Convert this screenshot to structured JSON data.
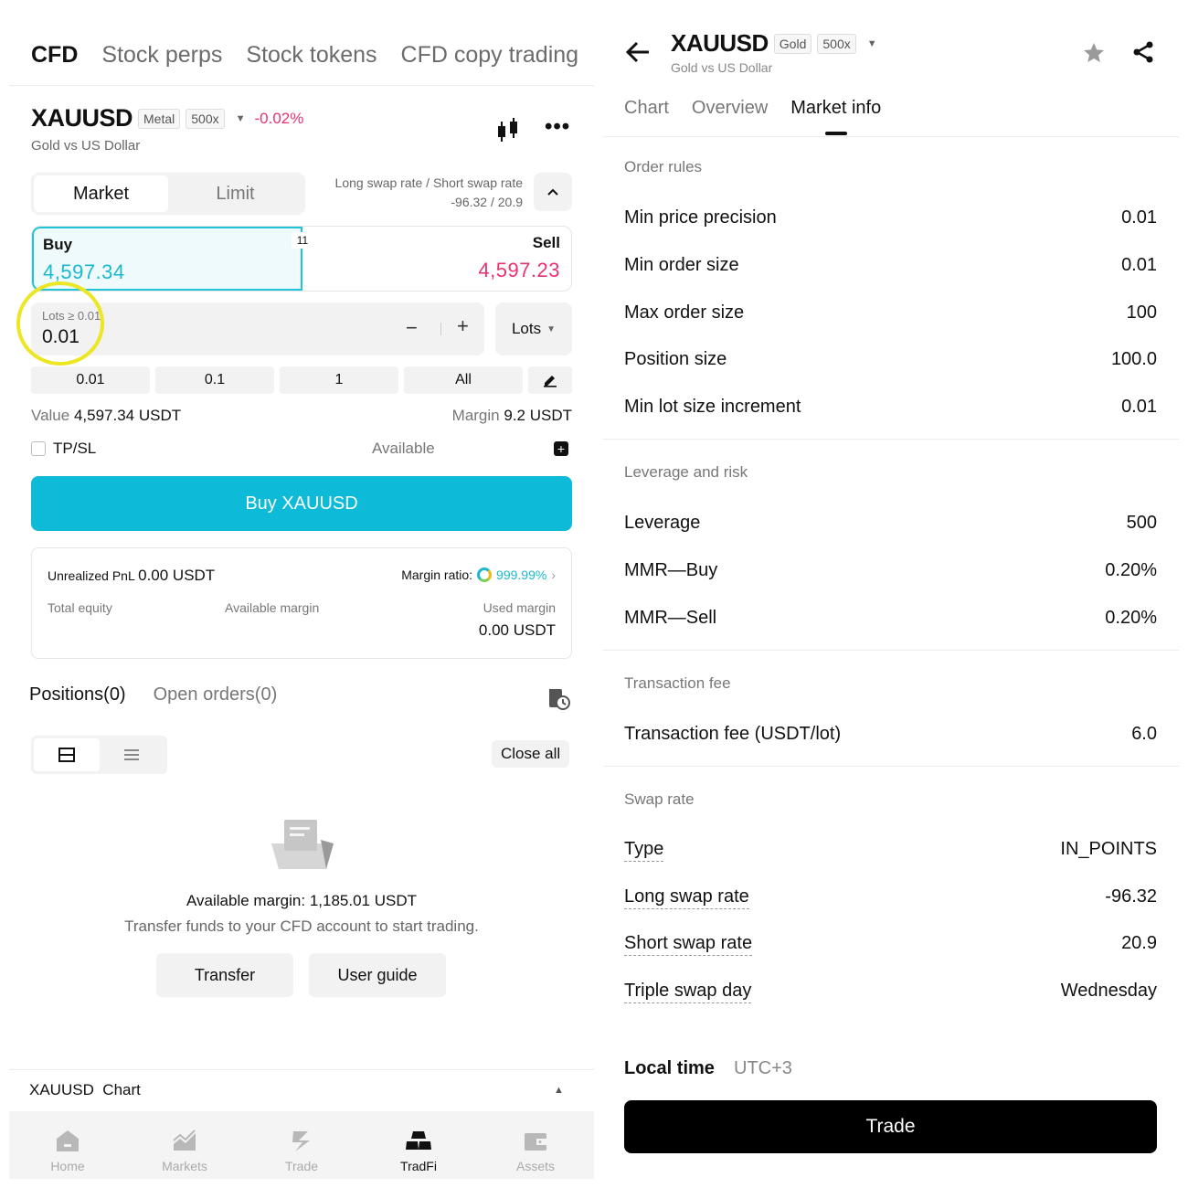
{
  "left": {
    "top_tabs": [
      "CFD",
      "Stock perps",
      "Stock tokens",
      "CFD copy trading"
    ],
    "symbol": "XAUUSD",
    "category_chip": "Metal",
    "leverage_chip": "500x",
    "change": "-0.02%",
    "subtitle": "Gold vs US Dollar",
    "icons": {
      "chart": "candlestick-icon",
      "more": "more-dots-icon"
    },
    "order_type": {
      "options": [
        "Market",
        "Limit"
      ],
      "selected": "Market"
    },
    "swap_rate_label": "Long swap rate / Short swap rate",
    "swap_rate_value": "-96.32 / 20.9",
    "buy": {
      "label": "Buy",
      "price": "4,597.34"
    },
    "spread": "11",
    "sell": {
      "label": "Sell",
      "price": "4,597.23"
    },
    "lots_placeholder": "Lots ≥ 0.01",
    "lots_value": "0.01",
    "stepper_minus": "−",
    "stepper_plus": "+",
    "unit_label": "Lots",
    "quick_amounts": [
      "0.01",
      "0.1",
      "1",
      "All"
    ],
    "value_label": "Value",
    "value": "4,597.34 USDT",
    "margin_label": "Margin",
    "margin": "9.2 USDT",
    "tpsl_label": "TP/SL",
    "available_label": "Available",
    "buy_button": "Buy XAUUSD",
    "pnl_label": "Unrealized PnL",
    "pnl_value": "0.00 USDT",
    "margin_ratio_label": "Margin ratio:",
    "margin_ratio_value": "999.99%",
    "total_equity_label": "Total equity",
    "available_margin_label": "Available margin",
    "used_margin_label": "Used margin",
    "used_margin_value": "0.00 USDT",
    "positions_tab": "Positions(0)",
    "open_orders_tab": "Open orders(0)",
    "close_all": "Close all",
    "available_margin_text": "Available margin: 1,185.01 USDT",
    "transfer_hint": "Transfer funds to your CFD account to start trading.",
    "transfer_button": "Transfer",
    "user_guide_button": "User guide",
    "chart_section": "XAUUSD  Chart",
    "bottom_nav": [
      {
        "label": "Home",
        "icon": "home-icon"
      },
      {
        "label": "Markets",
        "icon": "markets-icon"
      },
      {
        "label": "Trade",
        "icon": "trade-icon"
      },
      {
        "label": "TradFi",
        "icon": "tradfi-icon",
        "active": true
      },
      {
        "label": "Assets",
        "icon": "wallet-icon"
      }
    ]
  },
  "right": {
    "symbol": "XAUUSD",
    "category_chip": "Gold",
    "leverage_chip": "500x",
    "subtitle": "Gold vs US Dollar",
    "tabs": [
      "Chart",
      "Overview",
      "Market info"
    ],
    "active_tab": "Market info",
    "order_rules": {
      "title": "Order rules",
      "rows": [
        {
          "k": "Min price precision",
          "v": "0.01"
        },
        {
          "k": "Min order size",
          "v": "0.01"
        },
        {
          "k": "Max order size",
          "v": "100"
        },
        {
          "k": "Position size",
          "v": "100.0"
        },
        {
          "k": "Min lot size increment",
          "v": "0.01"
        }
      ]
    },
    "leverage_risk": {
      "title": "Leverage and risk",
      "rows": [
        {
          "k": "Leverage",
          "v": "500"
        },
        {
          "k": "MMR—Buy",
          "v": "0.20%"
        },
        {
          "k": "MMR—Sell",
          "v": "0.20%"
        }
      ]
    },
    "transaction_fee": {
      "title": "Transaction fee",
      "rows": [
        {
          "k": "Transaction fee (USDT/lot)",
          "v": "6.0"
        }
      ]
    },
    "swap_rate": {
      "title": "Swap rate",
      "rows": [
        {
          "k": "Type",
          "v": "IN_POINTS"
        },
        {
          "k": "Long swap rate",
          "v": "-96.32"
        },
        {
          "k": "Short swap rate",
          "v": "20.9"
        },
        {
          "k": "Triple swap day",
          "v": "Wednesday"
        }
      ]
    },
    "local_time_label": "Local time",
    "local_time_zone": "UTC+3",
    "trade_button": "Trade"
  },
  "colors": {
    "accent": "#0dbad8",
    "buy": "#1bb8cf",
    "sell": "#e8336d",
    "highlight": "#ece623"
  }
}
